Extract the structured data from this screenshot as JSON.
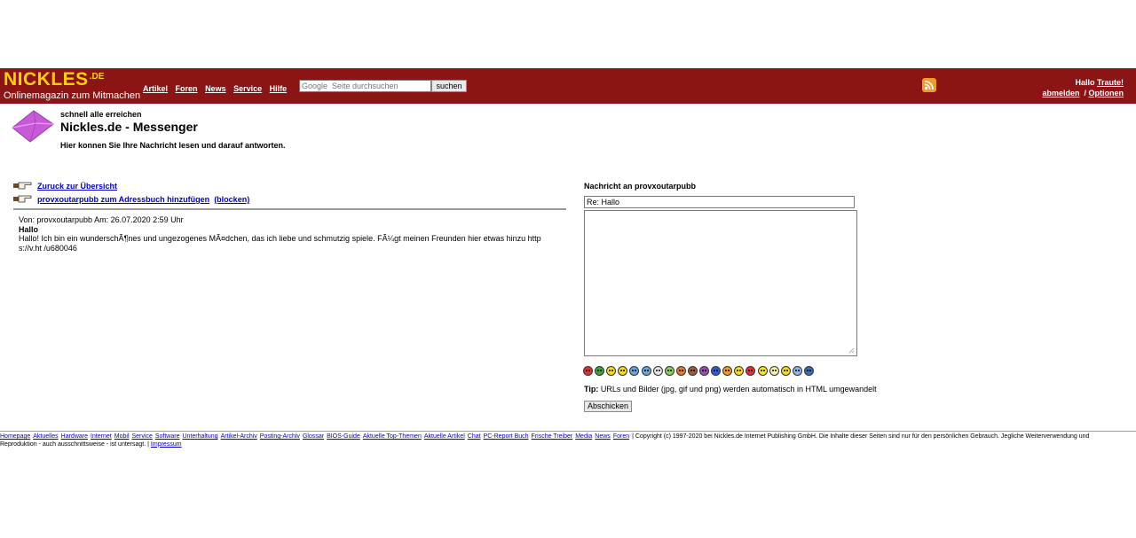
{
  "header": {
    "logo_word": "NICKLES",
    "logo_suffix": ".DE",
    "logo_tagline": "Onlinemagazin zum Mitmachen",
    "nav": [
      "Artikel",
      "Foren",
      "News",
      "Service",
      "Hilfe"
    ],
    "search_placeholder": "Google  Seite durchsuchen",
    "search_button": "suchen",
    "rss_icon": "rss-feed-icon",
    "greeting": "Hallo",
    "username": "Traute!",
    "logout": "abmelden",
    "separator": "/",
    "options": "Optionen"
  },
  "heading": {
    "kicker": "schnell alle erreichen",
    "title": "Nickles.de - Messenger",
    "intro": "Hier konnen Sie Ihre Nachricht lesen und darauf antworten.",
    "icon": "envelope-icon"
  },
  "message": {
    "back_link": "Zuruck zur Übersicht",
    "add_to_addressbook": "provxoutarpubb zum Adressbuch hinzufügen",
    "block": "(blocken)",
    "meta": "Von: provxoutarpubb Am: 26.07.2020 2:59 Uhr",
    "subject": "Hallo",
    "body": "Hallo! Ich bin ein wunderschÃ¶nes und ungezogenes MÃ¤dchen, das ich liebe und schmutzig spiele. FÃ¼gt meinen Freunden hier etwas hinzu https://v.ht /u680046"
  },
  "reply": {
    "heading": "Nachricht an provxoutarpubb",
    "subject_value": "Re: Hallo",
    "body_value": "",
    "tip_label": "Tip:",
    "tip_text": " URLs und Bilder (jpg, gif und png) werden automatisch in HTML umgewandelt",
    "submit": "Abschicken",
    "smileys": [
      {
        "name": "angry-smiley-icon",
        "color": "#e0303a"
      },
      {
        "name": "sick-smiley-icon",
        "color": "#3aa53a"
      },
      {
        "name": "grin-smiley-icon",
        "color": "#f6d91b"
      },
      {
        "name": "confused-smiley-icon",
        "color": "#f6d91b"
      },
      {
        "name": "cool-smiley-icon",
        "color": "#6aa4d8"
      },
      {
        "name": "crying-smiley-icon",
        "color": "#6aa4d8"
      },
      {
        "name": "ghost-smiley-icon",
        "color": "#e6e6e6"
      },
      {
        "name": "evil-smiley-icon",
        "color": "#8ccf5a"
      },
      {
        "name": "laugh-smiley-icon",
        "color": "#e37b2a"
      },
      {
        "name": "shock-smiley-icon",
        "color": "#9a5e3a"
      },
      {
        "name": "alien-smiley-icon",
        "color": "#a04ab8"
      },
      {
        "name": "sad-smiley-icon",
        "color": "#2b5fd8"
      },
      {
        "name": "tongue-smiley-icon",
        "color": "#f39a25"
      },
      {
        "name": "wink-smiley-icon",
        "color": "#f6d91b"
      },
      {
        "name": "mad-smiley-icon",
        "color": "#e0303a"
      },
      {
        "name": "smile-smiley-icon",
        "color": "#f6e21b"
      },
      {
        "name": "neutral-smiley-icon",
        "color": "#f6f0b0"
      },
      {
        "name": "rolleyes-smiley-icon",
        "color": "#f6d91b"
      },
      {
        "name": "computer-smiley-icon",
        "color": "#8fb6e8"
      },
      {
        "name": "nerd-smiley-icon",
        "color": "#3a6fb0"
      }
    ]
  },
  "footer": {
    "links": [
      "Homepage",
      "Aktuelles",
      "Hardware",
      "Internet",
      "Mobil",
      "Service",
      "Software",
      "Unterhaltung",
      "Artikel-Archiv",
      "Posting-Archiv",
      "Glossar",
      "BIOS-Guide",
      "Aktuelle Top-Themen",
      "Aktuelle Artikel",
      "Chat",
      "PC-Report Buch",
      "Frische Treiber",
      "Media",
      "News",
      "Foren"
    ],
    "copyright": "| Copyright (c) 1997-2020 bei Nickles.de Internet Publishing GmbH. Die Inhalte dieser Seiten sind nur für den persönlichen Gebrauch. Jegliche Weiterverwendung und Reproduktion - auch ausschnittsweise - ist untersagt. |",
    "impressum": "Impressum"
  },
  "colors": {
    "header_bg": "#8b1414",
    "logo_yellow": "#ffd200",
    "link_blue": "#0000cc",
    "envelope_purple": "#c85ad8"
  }
}
